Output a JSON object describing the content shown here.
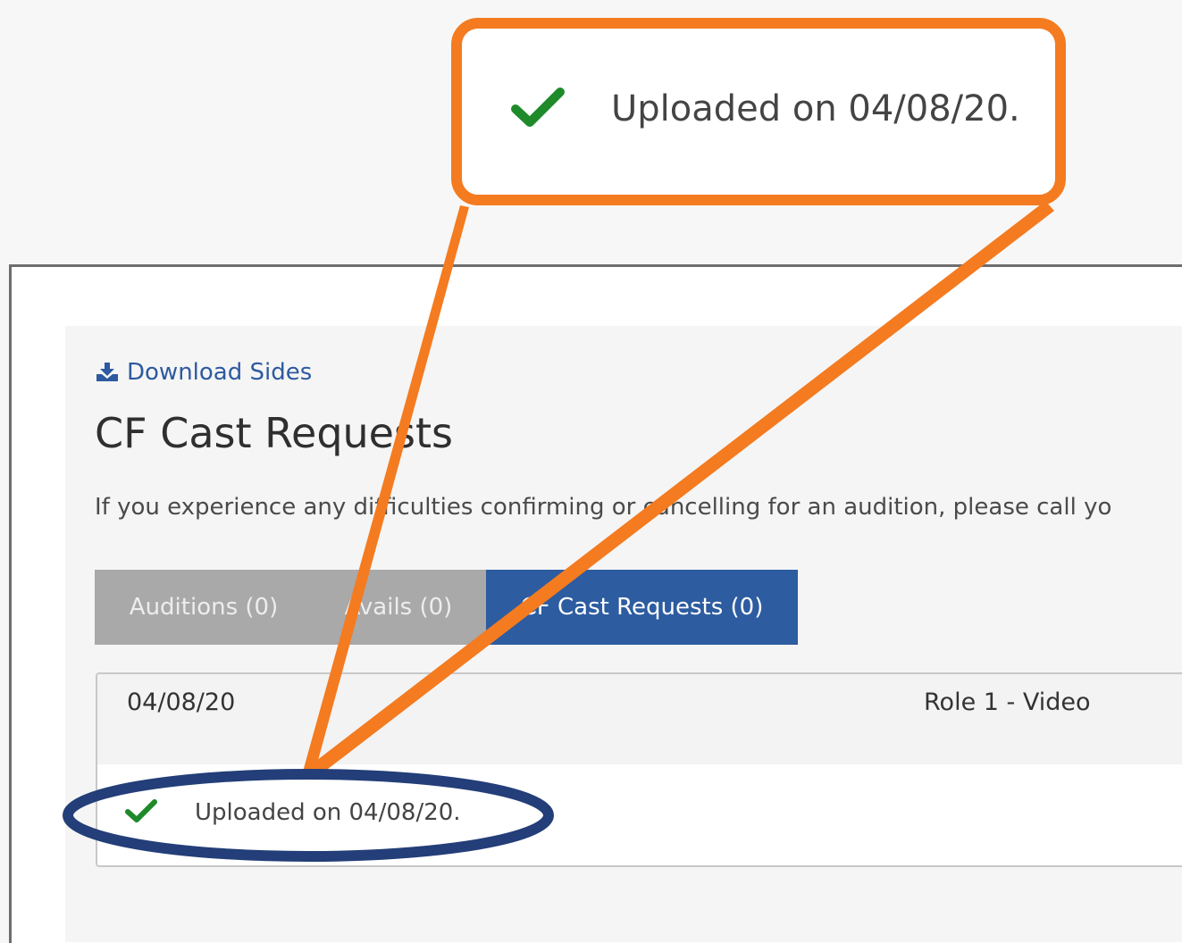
{
  "callout": {
    "status_text": "Uploaded on 04/08/20.",
    "border_color": "#f47b20",
    "icon": "checkmark-icon"
  },
  "links": {
    "download_sides": "Download Sides",
    "download_icon": "download-icon"
  },
  "page": {
    "title": "CF Cast Requests",
    "info": "If you experience any difficulties confirming or cancelling for an audition, please call yo"
  },
  "tabs": [
    {
      "label": "Auditions (0)",
      "active": false
    },
    {
      "label": "Avails (0)",
      "active": false
    },
    {
      "label": "CF Cast Requests (0)",
      "active": true
    }
  ],
  "request": {
    "date": "04/08/20",
    "role": "Role 1 - Video",
    "status_text": "Uploaded on 04/08/20.",
    "status_icon": "checkmark-icon"
  },
  "colors": {
    "accent_blue": "#2d5ca0",
    "tab_inactive": "#a9a9a9",
    "success_green": "#1e8a2a",
    "highlight_ellipse": "#233e78"
  }
}
